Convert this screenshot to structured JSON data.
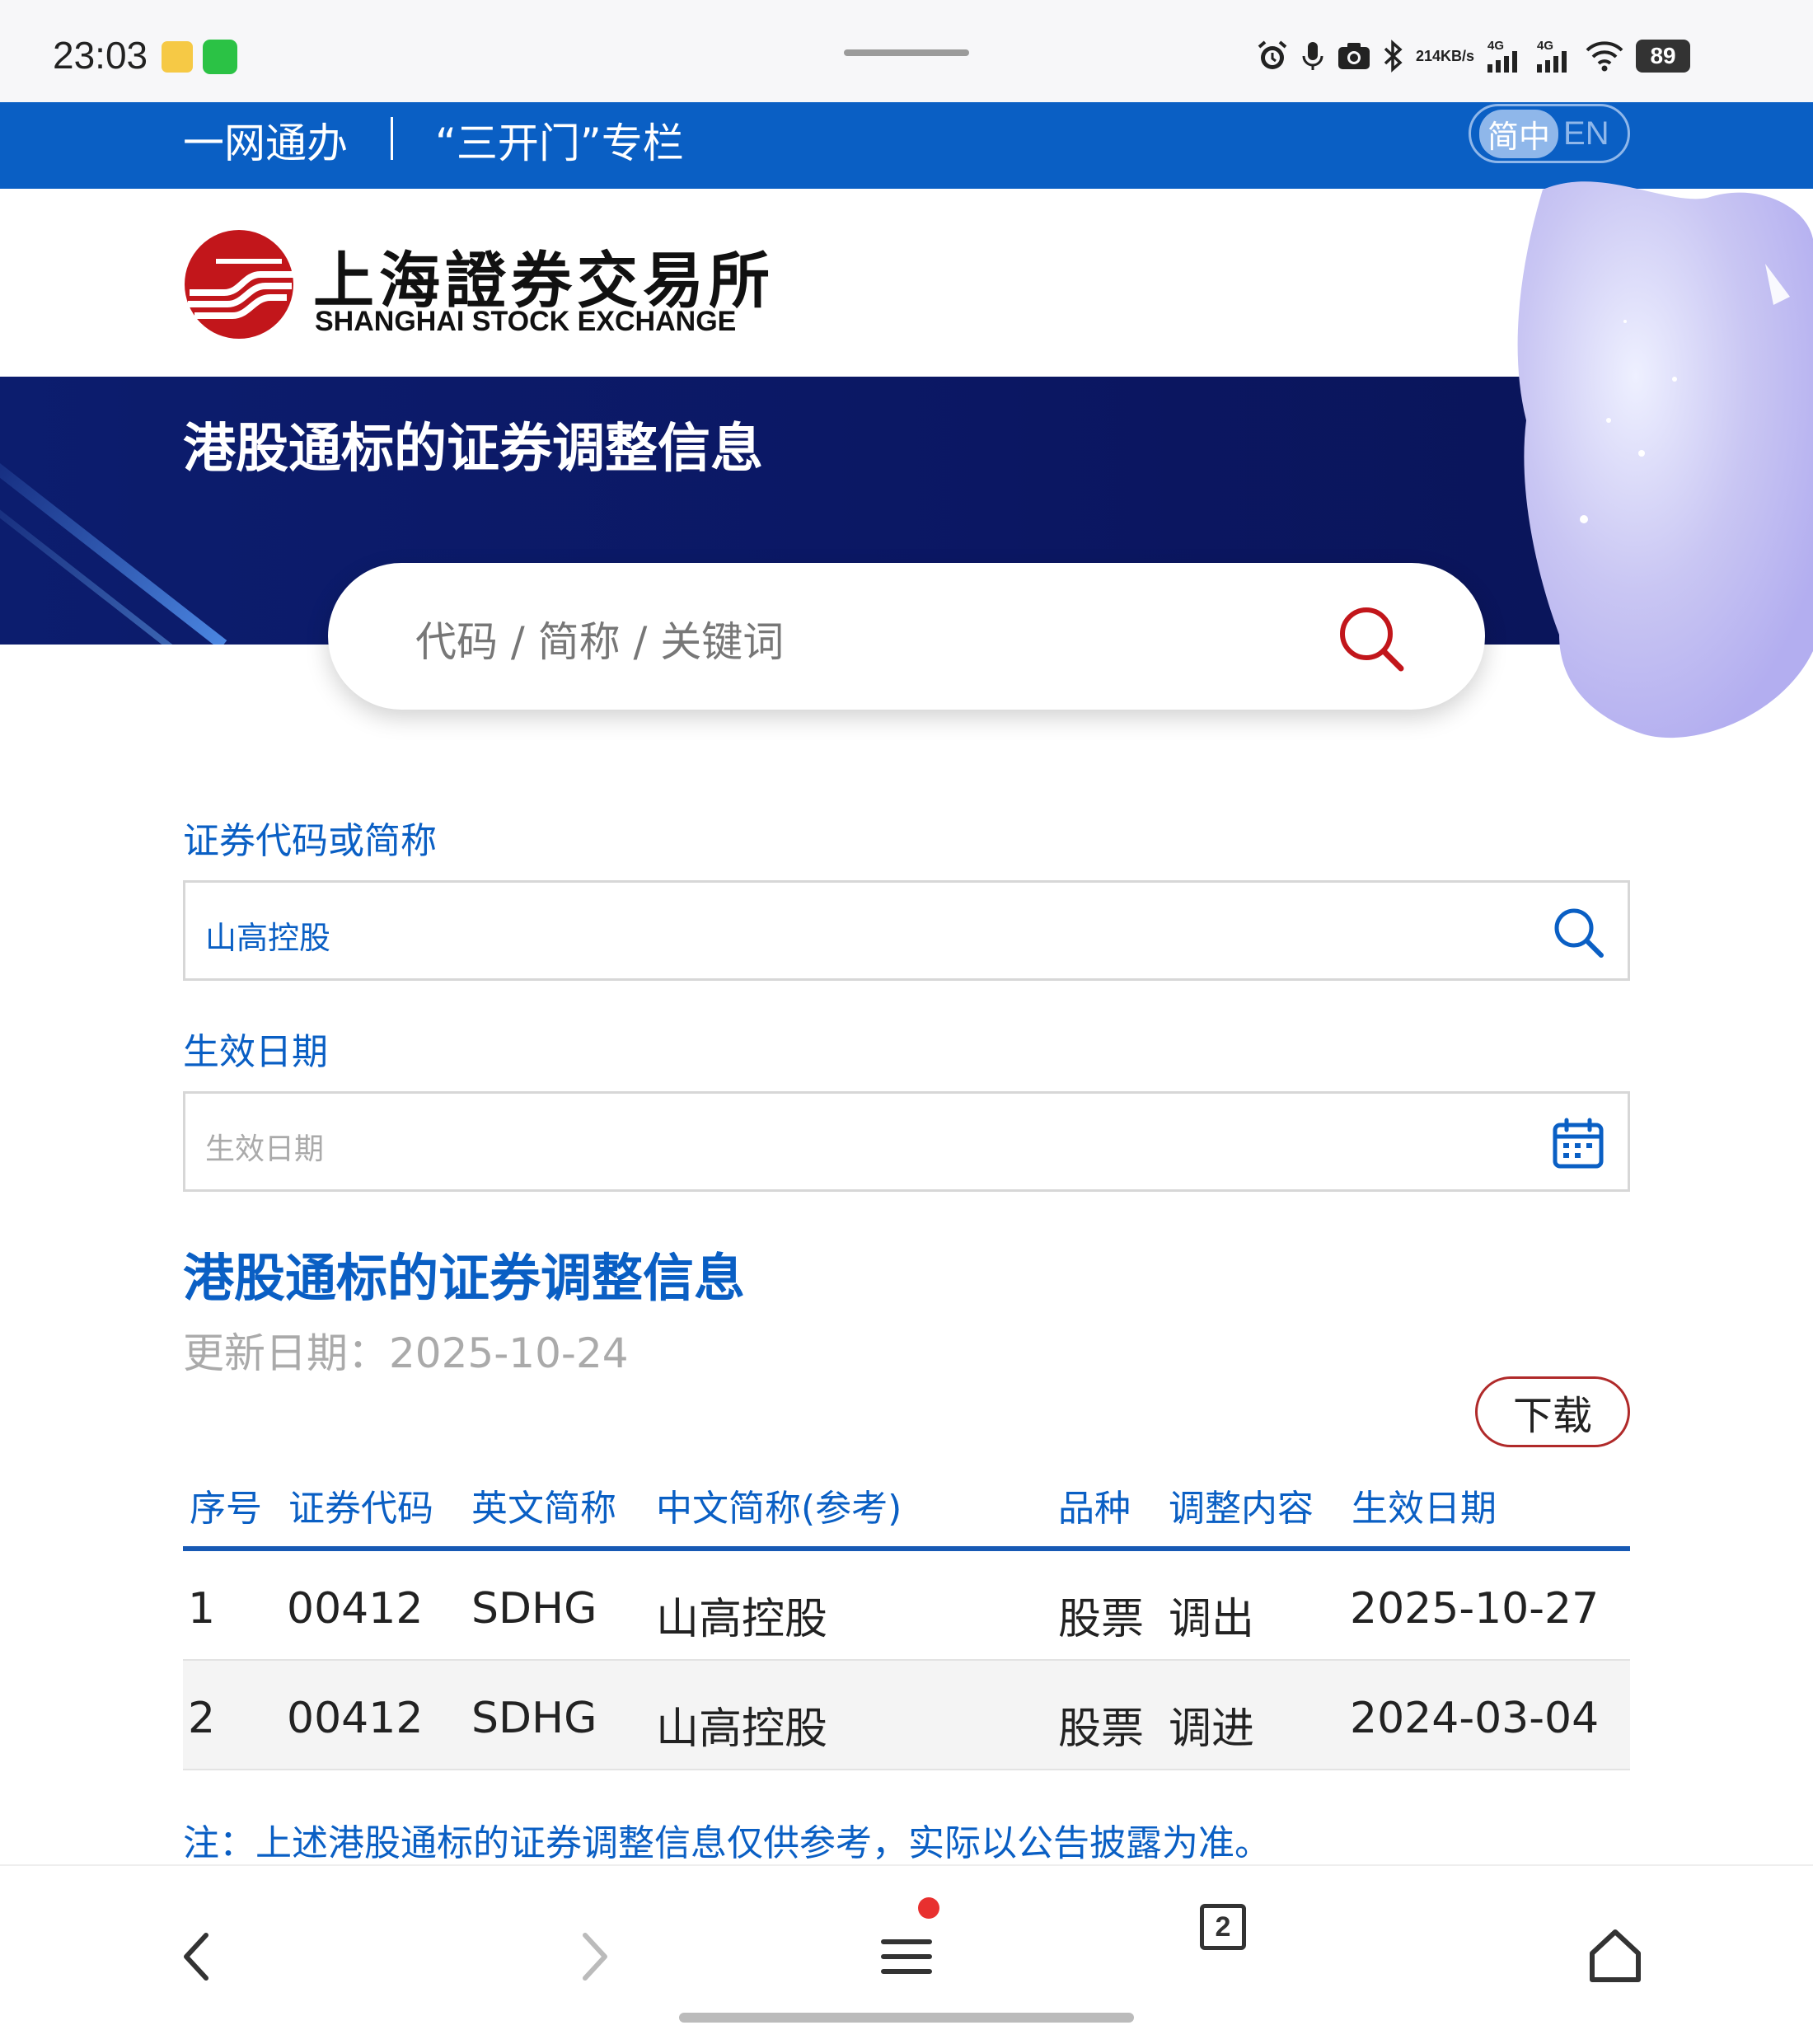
{
  "status_bar": {
    "time": "23:03",
    "net_speed_value": "214",
    "net_speed_unit": "KB/s",
    "signal1_label": "4G",
    "signal2_label": "4G",
    "battery": "89"
  },
  "top_nav": {
    "link1": "一网通办",
    "link2": "“三开门”专栏",
    "lang_zh": "简中",
    "lang_en": "EN"
  },
  "logo": {
    "cn": "上海證券交易所",
    "en": "SHANGHAI STOCK EXCHANGE"
  },
  "hero": {
    "title": "港股通标的证券调整信息",
    "search_placeholder": "代码 / 简称 / 关键词"
  },
  "form": {
    "code_label": "证券代码或简称",
    "code_value": "山高控股",
    "date_label": "生效日期",
    "date_placeholder": "生效日期"
  },
  "section": {
    "title": "港股通标的证券调整信息",
    "update_date": "更新日期：2025-10-24",
    "download_label": "下载"
  },
  "table": {
    "headers": [
      "序号",
      "证券代码",
      "英文简称",
      "中文简称(参考)",
      "品种",
      "调整内容",
      "生效日期"
    ],
    "rows": [
      [
        "1",
        "00412",
        "SDHG",
        "山高控股",
        "股票",
        "调出",
        "2025-10-27"
      ],
      [
        "2",
        "00412",
        "SDHG",
        "山高控股",
        "股票",
        "调进",
        "2024-03-04"
      ]
    ]
  },
  "note": "注：上述港股通标的证券调整信息仅供参考，实际以公告披露为准。",
  "bottom_bar": {
    "tab_count": "2"
  },
  "colors": {
    "brand_blue": "#0a5fc4",
    "hero_navy": "#0b1763",
    "accent_red": "#b02a2a"
  }
}
